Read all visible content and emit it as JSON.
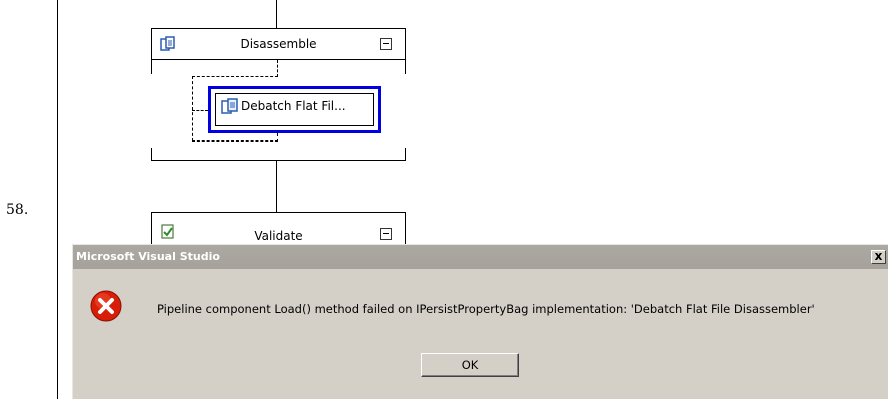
{
  "step": {
    "number": "58."
  },
  "pipeline": {
    "stages": [
      {
        "title": "Disassemble"
      },
      {
        "title": "Validate"
      }
    ],
    "component": {
      "label": "Debatch Flat Fil..."
    }
  },
  "dialog": {
    "title": "Microsoft Visual Studio",
    "close_label": "x",
    "message": "Pipeline component Load() method failed on IPersistPropertyBag implementation: 'Debatch Flat File Disassembler'",
    "ok_label": "OK",
    "icon": "error-icon"
  },
  "colors": {
    "selection": "#0000e0",
    "dialog_bg": "#d4d0c8",
    "titlebar_bg": "#a6a29b",
    "error_red": "#d81e06"
  }
}
